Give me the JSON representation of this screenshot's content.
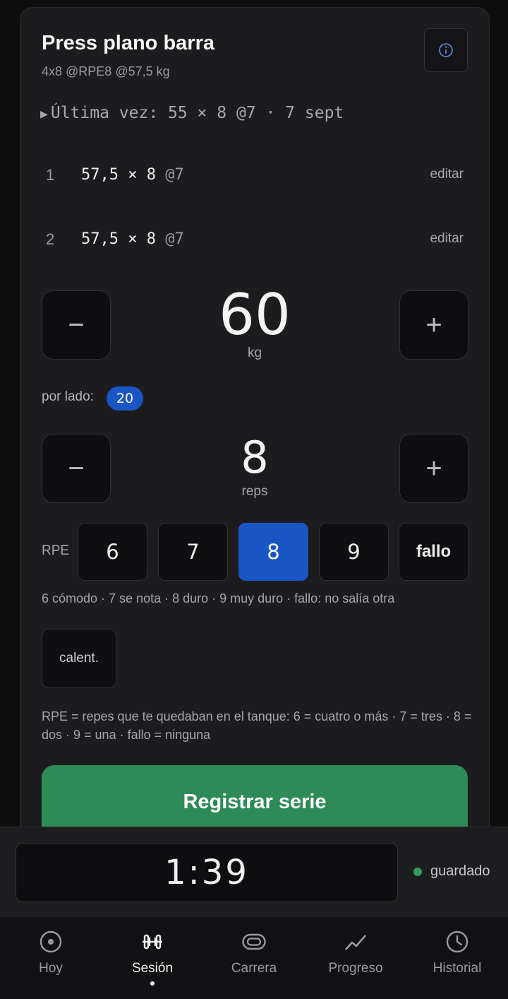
{
  "exercise": {
    "title": "Press plano barra",
    "subtitle": "4x8 @RPE8 @57,5 kg",
    "last_time": "Última vez: 55 × 8 @7 · 7 sept"
  },
  "sets": [
    {
      "num": "1",
      "value": "57,5 × 8 ",
      "rpe": "@7",
      "edit": "editar"
    },
    {
      "num": "2",
      "value": "57,5 × 8 ",
      "rpe": "@7",
      "edit": "editar"
    }
  ],
  "weight": {
    "value": "60",
    "unit": "kg",
    "minus": "−",
    "plus": "+"
  },
  "per_side": {
    "label": "por lado:",
    "value": "20"
  },
  "reps": {
    "value": "8",
    "unit": "reps",
    "minus": "−",
    "plus": "+"
  },
  "rpe": {
    "label": "RPE",
    "options": [
      "6",
      "7",
      "8",
      "9",
      "fallo"
    ],
    "selected": "8",
    "legend": "6 cómodo · 7 se nota · 8 duro · 9 muy duro · fallo: no salía otra"
  },
  "warmup_label": "calent.",
  "explanation": "RPE = repes que te quedaban en el tanque: 6 = cuatro o más · 7 = tres · 8 = dos · 9 = una · fallo = ninguna",
  "register_label": "Registrar serie",
  "timer": {
    "value": "1:39",
    "status": "guardado",
    "status_color": "#2e9e5c"
  },
  "nav": {
    "items": [
      {
        "label": "Hoy",
        "icon": "target-icon"
      },
      {
        "label": "Sesión",
        "icon": "dumbbell-icon"
      },
      {
        "label": "Carrera",
        "icon": "track-icon"
      },
      {
        "label": "Progreso",
        "icon": "trend-icon"
      },
      {
        "label": "Historial",
        "icon": "clock-icon"
      }
    ],
    "active": "Sesión"
  },
  "colors": {
    "accent": "#1a55c4",
    "primary_button": "#2e8b57",
    "background": "#1c1c1e"
  }
}
